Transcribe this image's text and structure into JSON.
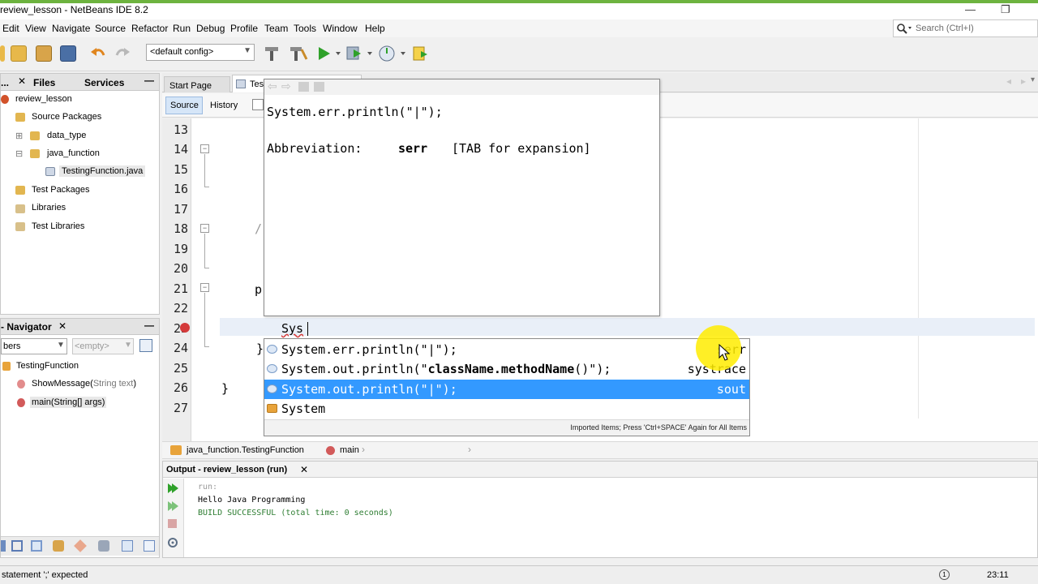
{
  "window": {
    "title": "review_lesson - NetBeans IDE 8.2",
    "minimize": "—",
    "restore": "❐"
  },
  "menu": [
    "Edit",
    "View",
    "Navigate",
    "Source",
    "Refactor",
    "Run",
    "Debug",
    "Profile",
    "Team",
    "Tools",
    "Window",
    "Help"
  ],
  "search": {
    "placeholder": "Search (Ctrl+I)"
  },
  "toolbar": {
    "config": "<default config>"
  },
  "projects_panel": {
    "tabs": [
      "Files",
      "Services"
    ],
    "tab_partial": "...",
    "project": "review_lesson",
    "source_packages": "Source Packages",
    "pkg_data_type": "data_type",
    "pkg_java_function": "java_function",
    "file": "TestingFunction.java",
    "test_packages": "Test Packages",
    "libraries": "Libraries",
    "test_libraries": "Test Libraries"
  },
  "navigator": {
    "title": "- Navigator",
    "members_combo": "bers",
    "filter_combo": "<empty>",
    "class": "TestingFunction",
    "method1_name": "ShowMessage(",
    "method1_param": "String text",
    "method1_close": ")",
    "method2": "main(String[] args)"
  },
  "editor": {
    "tabs": [
      "Start Page",
      "Tes"
    ],
    "source_btn": "Source",
    "history_btn": "History",
    "line_numbers": [
      "13",
      "14",
      "15",
      "16",
      "17",
      "18",
      "19",
      "20",
      "21",
      "22",
      "23",
      "24",
      "25",
      "26",
      "27"
    ],
    "code_fragments": {
      "l18": "/",
      "l21": "p",
      "l23": "Sys",
      "l24": "}",
      "l26": "}"
    }
  },
  "doc_popup": {
    "code": "System.err.println(\"|\");",
    "abbr_label": "Abbreviation:",
    "abbr_value": "serr",
    "abbr_hint": "[TAB for expansion]"
  },
  "completion": {
    "items": [
      {
        "pre": "System.err.println(\"|\");",
        "bold": "",
        "post": "",
        "abbr": "serr",
        "selected": false
      },
      {
        "pre": "System.out.println(\"",
        "bold": "className.methodName",
        "post": "()\");",
        "abbr": "systrace",
        "selected": false
      },
      {
        "pre": "System.out.println(\"|\");",
        "bold": "",
        "post": "",
        "abbr": "sout",
        "selected": true
      },
      {
        "pre": "System",
        "bold": "",
        "post": "",
        "abbr": "",
        "selected": false
      }
    ],
    "footer": "Imported Items; Press 'Ctrl+SPACE' Again for All Items"
  },
  "breadcrumb": {
    "class": "java_function.TestingFunction",
    "method": "main"
  },
  "output": {
    "title": "Output - review_lesson (run)",
    "lines": [
      "run:",
      "Hello Java Programming",
      "BUILD SUCCESSFUL (total time: 0 seconds)"
    ]
  },
  "status": {
    "message": "statement ';' expected",
    "position": "23:11"
  },
  "colors": {
    "selection": "#3399ff",
    "output_green": "#2e7d32",
    "accent": "#6db33f"
  }
}
